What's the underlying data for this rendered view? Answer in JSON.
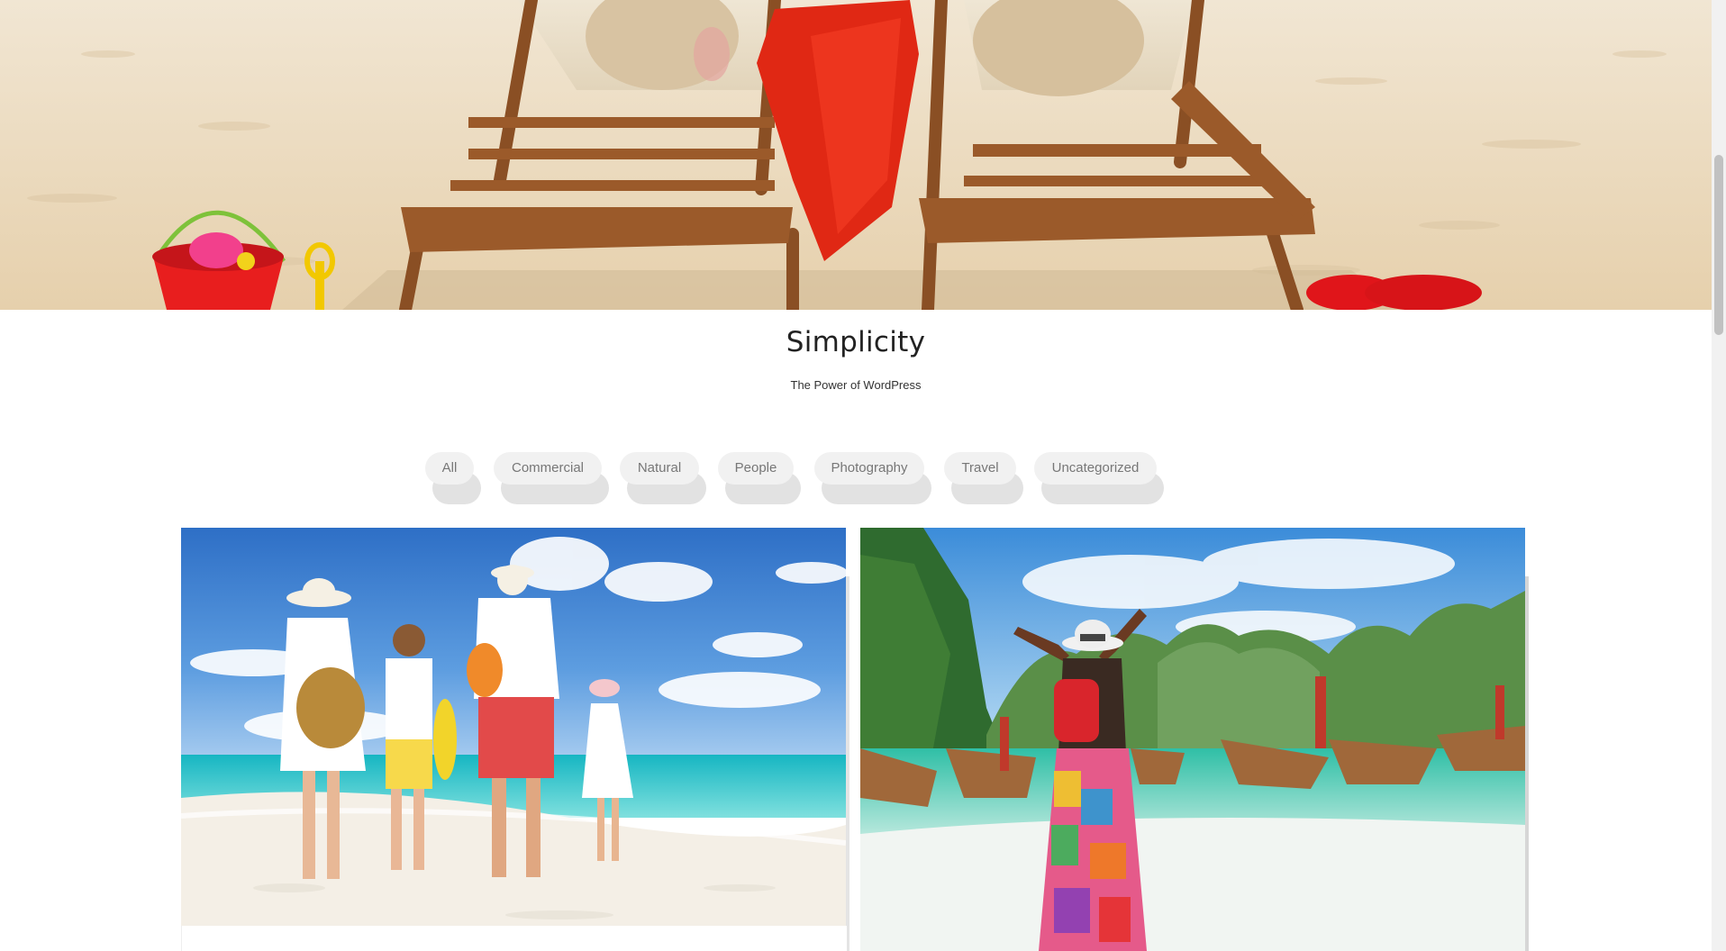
{
  "site": {
    "title": "Simplicity",
    "tagline": "The Power of WordPress"
  },
  "hero": {
    "image_subject": "beach-chairs-hero-image"
  },
  "filters": [
    {
      "label": "All"
    },
    {
      "label": "Commercial"
    },
    {
      "label": "Natural"
    },
    {
      "label": "People"
    },
    {
      "label": "Photography"
    },
    {
      "label": "Travel"
    },
    {
      "label": "Uncategorized"
    }
  ],
  "portfolio": {
    "items": [
      {
        "image_subject": "family-beach-walk-image"
      },
      {
        "image_subject": "traveler-longtail-boats-image"
      }
    ]
  },
  "colors": {
    "title": "#222222",
    "filter_text": "#777777",
    "filter_bg": "#f1f1f1",
    "filter_shadow": "#e2e2e2"
  }
}
